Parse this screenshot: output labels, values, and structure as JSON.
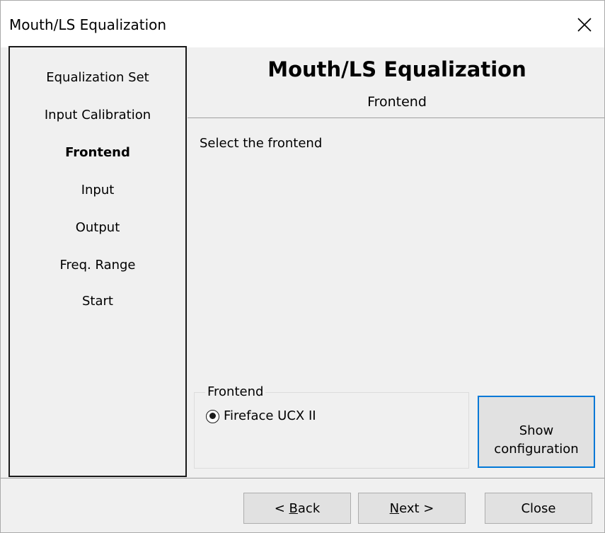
{
  "window": {
    "title": "Mouth/LS Equalization"
  },
  "sidebar": {
    "steps": [
      {
        "label": "Equalization Set",
        "active": false
      },
      {
        "label": "Input Calibration",
        "active": false
      },
      {
        "label": "Frontend",
        "active": true
      },
      {
        "label": "Input",
        "active": false
      },
      {
        "label": "Output",
        "active": false
      },
      {
        "label": "Freq. Range",
        "active": false
      },
      {
        "label": "Start",
        "active": false
      }
    ]
  },
  "header": {
    "title": "Mouth/LS Equalization",
    "subtitle": "Frontend"
  },
  "main": {
    "instruction": "Select the frontend",
    "frontend_group": {
      "legend": "Frontend",
      "options": [
        {
          "label": "Fireface UCX II",
          "selected": true
        }
      ]
    },
    "show_config_button": {
      "line1": "Show",
      "line2": "configuration"
    }
  },
  "footer": {
    "back": {
      "pre": "< ",
      "accel": "B",
      "post": "ack"
    },
    "next": {
      "pre": "",
      "accel": "N",
      "post": "ext >"
    },
    "close": "Close"
  },
  "colors": {
    "background": "#f0f0f0",
    "titlebar": "#ffffff",
    "focus_border": "#0078d7",
    "button_face": "#e1e1e1"
  },
  "icons": {
    "close": "close-icon",
    "radio": "radio-selected-icon"
  }
}
